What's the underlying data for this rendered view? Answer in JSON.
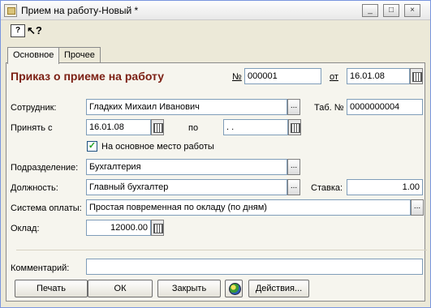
{
  "window": {
    "title": "Прием на работу-Новый *",
    "controls": [
      "_",
      "□",
      "×"
    ]
  },
  "toolbar": {
    "help_glyph": "?",
    "pointer_glyph": "↖?"
  },
  "tabs": [
    {
      "label": "Основное",
      "active": true
    },
    {
      "label": "Прочее",
      "active": false
    }
  ],
  "form": {
    "heading": "Приказ о приеме на работу",
    "number_label": "№",
    "number_value": "000001",
    "date_label": "от",
    "date_value": "16.01.08",
    "employee_label": "Сотрудник:",
    "employee_value": "Гладких Михаил Иванович",
    "tab_number_label": "Таб. №",
    "tab_number_value": "0000000004",
    "hire_from_label": "Принять с",
    "hire_from_value": "16.01.08",
    "hire_to_label": "по",
    "hire_to_value": " .  .",
    "main_workplace_label": "На основное место работы",
    "main_workplace_checked": true,
    "department_label": "Подразделение:",
    "department_value": "Бухгалтерия",
    "position_label": "Должность:",
    "position_value": "Главный бухгалтер",
    "rate_label": "Ставка:",
    "rate_value": "1.00",
    "pay_system_label": "Система оплаты:",
    "pay_system_value": "Простая повременная по окладу (по дням)",
    "salary_label": "Оклад:",
    "salary_value": "12000.00",
    "comment_label": "Комментарий:",
    "comment_value": ""
  },
  "buttons": {
    "print": "Печать",
    "ok": "ОК",
    "close": "Закрыть",
    "actions": "Действия..."
  },
  "icons": {
    "ellipsis": "...",
    "pick": "..."
  },
  "colors": {
    "heading": "#7b1f13",
    "field_border": "#7f9db9",
    "panel_bg": "#f6f5ee",
    "window_bg": "#ece9d8"
  }
}
